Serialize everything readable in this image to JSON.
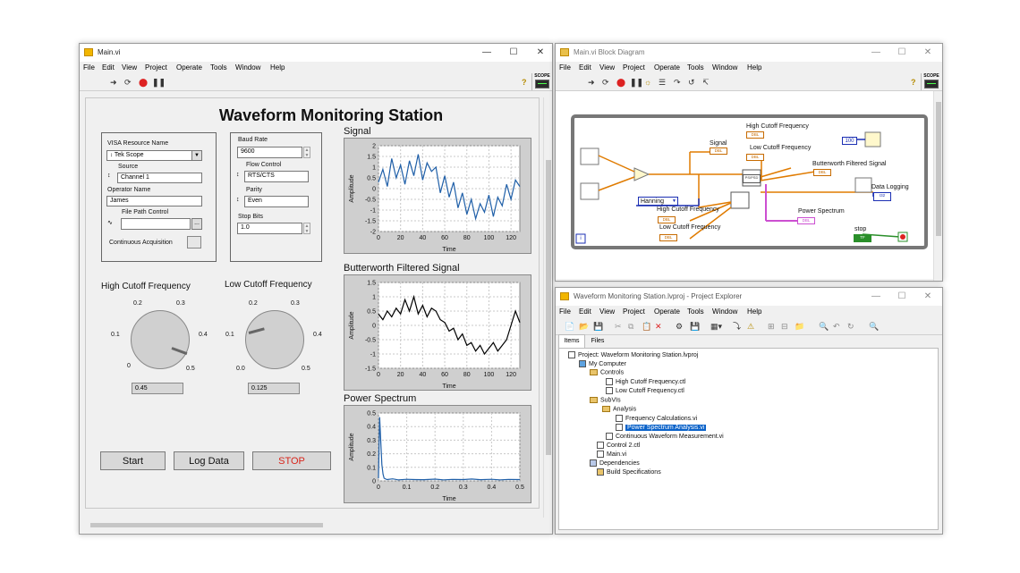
{
  "main_vi": {
    "title": "Main.vi",
    "menu": [
      "File",
      "Edit",
      "View",
      "Project",
      "Operate",
      "Tools",
      "Window",
      "Help"
    ],
    "scope_label": "SCOPE",
    "panel_title": "Waveform Monitoring Station",
    "visa_label": "VISA Resource Name",
    "visa_value": "Tek Scope",
    "source_label": "Source",
    "source_value": "Channel 1",
    "operator_label": "Operator Name",
    "operator_value": "James",
    "filepath_label": "File Path Control",
    "cont_acq_label": "Continuous Acquisition",
    "baud_label": "Baud Rate",
    "baud_value": "9600",
    "flow_label": "Flow Control",
    "flow_value": "RTS/CTS",
    "parity_label": "Parity",
    "parity_value": "Even",
    "stopbits_label": "Stop Bits",
    "stopbits_value": "1.0",
    "high_knob_label": "High Cutoff Frequency",
    "high_knob_value": "0.45",
    "low_knob_label": "Low Cutoff Frequency",
    "low_knob_value": "0.125",
    "knob_ticks": [
      "0.1",
      "0.2",
      "0.3",
      "0.4",
      "0.5",
      "0"
    ],
    "knob_ticks_low": [
      "0.1",
      "0.2",
      "0.3",
      "0.4",
      "0.5",
      "0.0"
    ],
    "start_label": "Start",
    "log_label": "Log Data",
    "stop_label": "STOP"
  },
  "chart_data": [
    {
      "type": "line",
      "title": "Signal",
      "xlabel": "Time",
      "ylabel": "Amplitude",
      "xlim": [
        0,
        128
      ],
      "ylim": [
        -2,
        2
      ],
      "xticks": [
        "0",
        "20",
        "40",
        "60",
        "80",
        "100",
        "120"
      ],
      "yticks": [
        "2",
        "1.5",
        "1",
        "0.5",
        "0",
        "-0.5",
        "-1",
        "-1.5",
        "-2"
      ],
      "color": "#1f5fa8",
      "x": [
        0,
        4,
        8,
        12,
        16,
        20,
        24,
        28,
        32,
        36,
        40,
        44,
        48,
        52,
        56,
        60,
        64,
        68,
        72,
        76,
        80,
        84,
        88,
        92,
        96,
        100,
        104,
        108,
        112,
        116,
        120,
        124,
        128
      ],
      "y": [
        0.3,
        0.9,
        0.1,
        1.4,
        0.5,
        1.1,
        0.2,
        1.3,
        0.6,
        1.6,
        0.4,
        1.2,
        0.8,
        1.0,
        -0.2,
        0.6,
        -0.4,
        0.3,
        -0.9,
        -0.2,
        -1.2,
        -0.5,
        -1.4,
        -0.7,
        -1.1,
        -0.3,
        -1.3,
        -0.4,
        -0.8,
        0.2,
        -0.5,
        0.4,
        0.1
      ]
    },
    {
      "type": "line",
      "title": "Butterworth Filtered Signal",
      "xlabel": "Time",
      "ylabel": "Amplitude",
      "xlim": [
        0,
        128
      ],
      "ylim": [
        -1.5,
        1.5
      ],
      "xticks": [
        "0",
        "20",
        "40",
        "60",
        "80",
        "100",
        "120"
      ],
      "yticks": [
        "1.5",
        "1",
        "0.5",
        "0",
        "-0.5",
        "-1",
        "-1.5"
      ],
      "color": "#000000",
      "x": [
        0,
        4,
        8,
        12,
        16,
        20,
        24,
        28,
        32,
        36,
        40,
        44,
        48,
        52,
        56,
        60,
        64,
        68,
        72,
        76,
        80,
        84,
        88,
        92,
        96,
        100,
        104,
        108,
        112,
        116,
        120,
        124,
        128
      ],
      "y": [
        0.4,
        0.2,
        0.5,
        0.3,
        0.6,
        0.4,
        0.9,
        0.5,
        1.0,
        0.4,
        0.7,
        0.3,
        0.6,
        0.5,
        0.2,
        0.1,
        -0.2,
        -0.1,
        -0.5,
        -0.3,
        -0.7,
        -0.6,
        -0.9,
        -0.7,
        -1.0,
        -0.8,
        -0.6,
        -0.9,
        -0.7,
        -0.5,
        0.0,
        0.5,
        0.1
      ]
    },
    {
      "type": "line",
      "title": "Power Spectrum",
      "xlabel": "Time",
      "ylabel": "Amplitude",
      "xlim": [
        0,
        0.5
      ],
      "ylim": [
        0,
        0.5
      ],
      "xticks": [
        "0",
        "0.1",
        "0.2",
        "0.3",
        "0.4",
        "0.5"
      ],
      "yticks": [
        "0.5",
        "0.4",
        "0.3",
        "0.2",
        "0.1",
        "0"
      ],
      "color": "#1f5fa8",
      "x": [
        0,
        0.004,
        0.008,
        0.012,
        0.016,
        0.02,
        0.03,
        0.05,
        0.07,
        0.1,
        0.13,
        0.16,
        0.2,
        0.23,
        0.26,
        0.3,
        0.33,
        0.36,
        0.4,
        0.43,
        0.46,
        0.5
      ],
      "y": [
        0.02,
        0.47,
        0.3,
        0.12,
        0.05,
        0.02,
        0.01,
        0.015,
        0.008,
        0.012,
        0.01,
        0.009,
        0.013,
        0.008,
        0.011,
        0.01,
        0.014,
        0.009,
        0.012,
        0.008,
        0.011,
        0.01
      ]
    }
  ],
  "block_diagram": {
    "title": "Main.vi Block Diagram",
    "menu": [
      "File",
      "Edit",
      "View",
      "Project",
      "Operate",
      "Tools",
      "Window",
      "Help"
    ],
    "labels": {
      "high_cutoff_top": "High Cutoff Frequency",
      "signal": "Signal",
      "low_cutoff_top": "Low Cutoff Frequency",
      "butterworth": "Butterworth Filtered Signal",
      "data_logging": "Data Logging",
      "hanning": "Hanning",
      "high_cutoff_bottom": "High Cutoff Frequency",
      "low_cutoff_bottom": "Low Cutoff Frequency",
      "power_spectrum": "Power Spectrum",
      "stop": "stop",
      "const_100": "100",
      "dbl": "DBL",
      "i32": "I32",
      "tf": "TF",
      "ps_psd": "PS/PSD",
      "iter": "i"
    }
  },
  "project_explorer": {
    "title": "Waveform Monitoring Station.lvproj - Project Explorer",
    "menu": [
      "File",
      "Edit",
      "View",
      "Project",
      "Operate",
      "Tools",
      "Window",
      "Help"
    ],
    "tabs": [
      "Items",
      "Files"
    ],
    "tree": [
      "Project: Waveform Monitoring Station.lvproj",
      "My Computer",
      "Controls",
      "High Cutoff Frequency.ctl",
      "Low Cutoff Frequency.ctl",
      "SubVIs",
      "Analysis",
      "Frequency Calculations.vi",
      "Power Spectrum Analysis.vi",
      "Continuous Waveform Measurement.vi",
      "Control 2.ctl",
      "Main.vi",
      "Dependencies",
      "Build Specifications"
    ]
  }
}
